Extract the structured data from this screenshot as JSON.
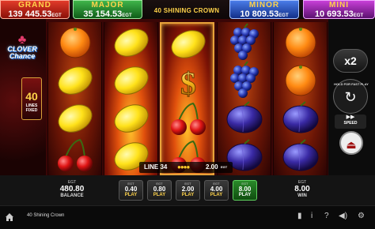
{
  "jackpots": {
    "grand": {
      "name": "GRAND",
      "value": "139 445.53",
      "currency": "EGT"
    },
    "major": {
      "name": "MAJOR",
      "value": "35 154.53",
      "currency": "EGT"
    },
    "minor": {
      "name": "MINOR",
      "value": "10 809.53",
      "currency": "EGT"
    },
    "mini": {
      "name": "MINI",
      "value": "10 693.53",
      "currency": "EGT"
    }
  },
  "game_title": "40 SHINING CROWN",
  "game_id": "4A806A3D52DB2C80E3F5C",
  "logo": {
    "text_line1": "CLOVER",
    "text_line2": "Chance"
  },
  "lines": {
    "count": "40",
    "label1": "LINES",
    "label2": "FIXED"
  },
  "reels": [
    [
      "orange",
      "lemon",
      "lemon",
      "cherry"
    ],
    [
      "lemon",
      "lemon",
      "lemon",
      "lemon"
    ],
    [
      "lemon",
      "dollar",
      "cherry",
      "cherry"
    ],
    [
      "grape",
      "grape",
      "plum",
      "plum"
    ],
    [
      "orange",
      "orange",
      "plum",
      "plum"
    ]
  ],
  "right_panel": {
    "multiplier_label": "x2",
    "hold_label": "HOLD FOR FAST PLAY",
    "speed_label": "SPEED"
  },
  "line_win": {
    "label": "LINE 34",
    "value": "2.00",
    "currency": "EGT"
  },
  "balance": {
    "currency": "EGT",
    "value": "480.80",
    "label": "BALANCE"
  },
  "bets": [
    {
      "currency": "EGT",
      "value": "0.40",
      "label": "PLAY",
      "selected": false
    },
    {
      "currency": "EGT",
      "value": "0.80",
      "label": "PLAY",
      "selected": false
    },
    {
      "currency": "EGT",
      "value": "2.00",
      "label": "PLAY",
      "selected": false
    },
    {
      "currency": "EGT",
      "value": "4.00",
      "label": "PLAY",
      "selected": false
    },
    {
      "currency": "EGT",
      "value": "8.00",
      "label": "PLAY",
      "selected": true
    }
  ],
  "win": {
    "currency": "EGT",
    "value": "8.00",
    "label": "WIN"
  },
  "status_bar": {
    "title": "40 Shining Crown"
  },
  "colors": {
    "accent_gold": "#ffd34a",
    "selected_bet": "#2a8a2a"
  }
}
